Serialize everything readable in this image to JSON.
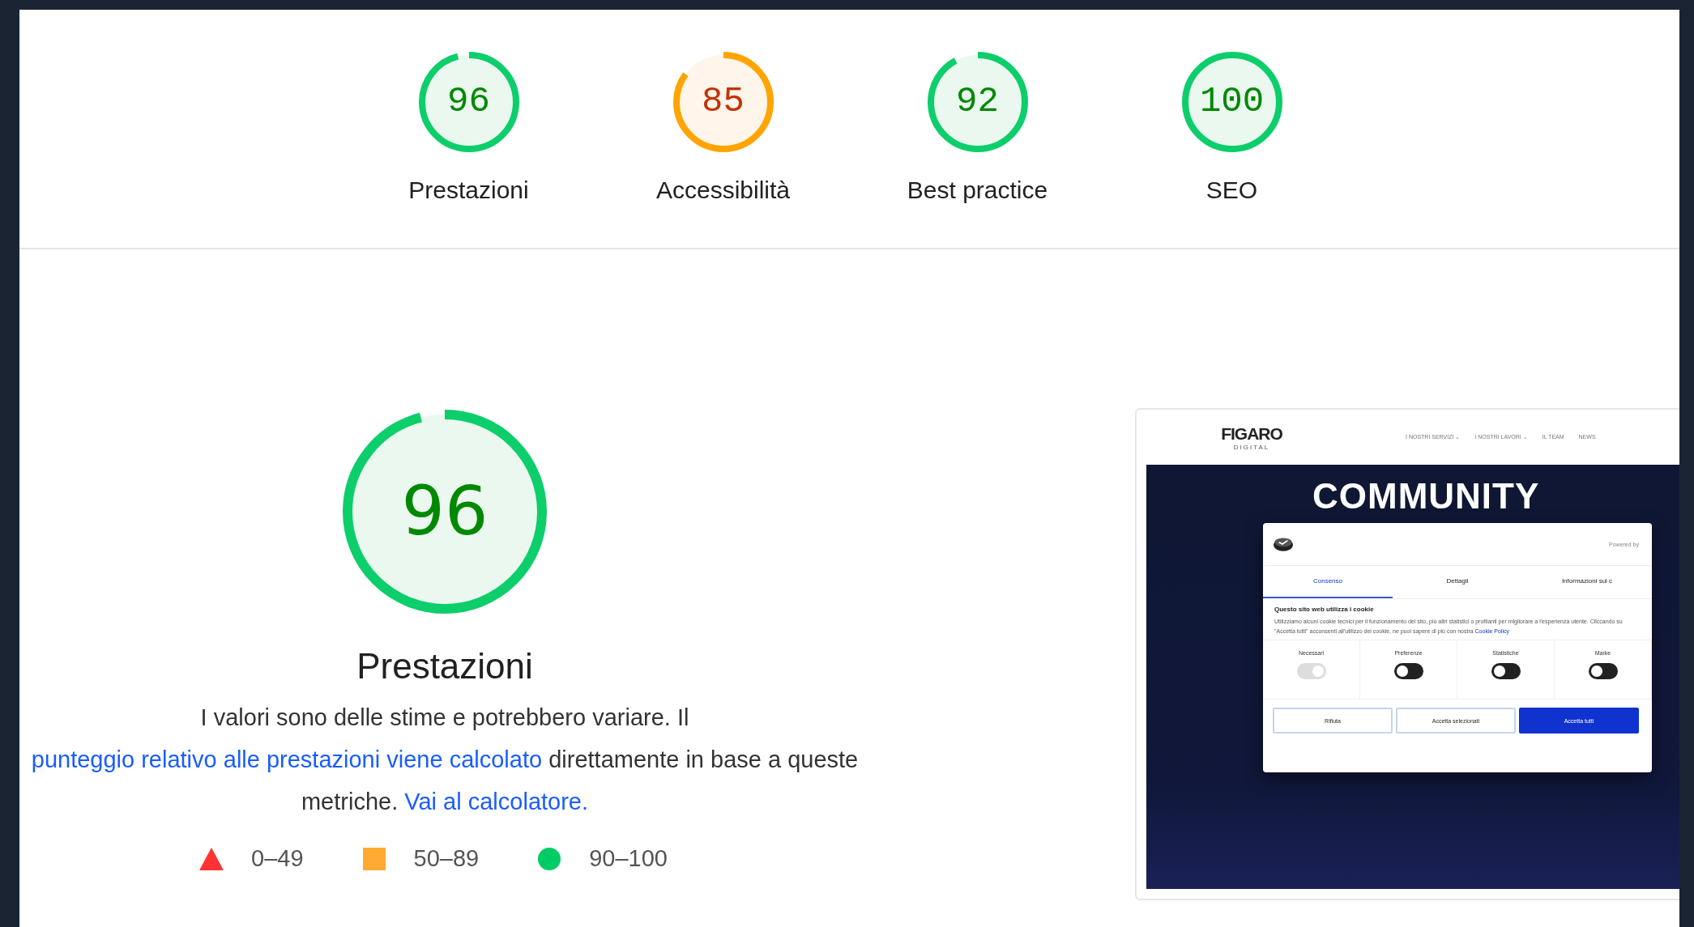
{
  "categories": [
    {
      "score": "96",
      "level": 0.96,
      "label": "Prestazioni"
    },
    {
      "score": "85",
      "level": 0.85,
      "label": "Accessibilità"
    },
    {
      "score": "92",
      "level": 0.92,
      "label": "Best practice"
    },
    {
      "score": "100",
      "level": 1,
      "label": "SEO"
    }
  ],
  "performance": {
    "score": "96",
    "level": 0.96,
    "title": "Prestazioni",
    "description": [
      {
        "text": "I valori sono delle stime e potrebbero variare. Il ",
        "kind": "text"
      },
      {
        "text": "punteggio relativo alle ",
        "kind": "link"
      },
      {
        "text": "prestazioni viene calcolato",
        "kind": "link"
      },
      {
        "text": " direttamente in base a queste metriche. ",
        "kind": "text"
      },
      {
        "text": "Vai al ",
        "kind": "link"
      },
      {
        "text": "calcolatore.",
        "kind": "link"
      }
    ],
    "legend": [
      {
        "kind": "triangle",
        "color": "#ff3333",
        "label": "0–49"
      },
      {
        "kind": "square",
        "color": "#ffaa33",
        "label": "50–89"
      },
      {
        "kind": "circle",
        "color": "#00cc66",
        "label": "90–100"
      }
    ]
  },
  "thumbnail": {
    "logo": "FIGARO",
    "logo_sub": "DIGITAL",
    "nav": [
      "I NOSTRI SERVIZI ⌄",
      "I NOSTRI LAVORI ⌄",
      "IL TEAM",
      "NEWS"
    ],
    "hero": "COMMUNITY",
    "dialog": {
      "powered": "Powered by",
      "tabs": [
        {
          "label": "Consenso",
          "selected": true
        },
        {
          "label": "Dettagli",
          "selected": false
        },
        {
          "label": "Informazioni sui c",
          "selected": false
        }
      ],
      "heading": "Questo sito web utilizza i cookie",
      "body": "Utilizziamo alcuni cookie tecnici per il funzionamento del sito, più altri statistici o profilanti per migliorare a l'esperienza utente. Cliccando su \"Accetta tutti\" acconsenti all'utilizzo dei cookie, ne puoi sapere di più con",
      "policy_prefix": "nostra",
      "policy_link": "Cookie Policy",
      "toggles": [
        {
          "label": "Necessari",
          "on": true,
          "disabled": true
        },
        {
          "label": "Preferenze",
          "on": false,
          "disabled": false
        },
        {
          "label": "Statistiche",
          "on": false,
          "disabled": false
        },
        {
          "label": "Marke",
          "on": false,
          "disabled": false
        }
      ],
      "buttons": [
        {
          "label": "Rifiuta",
          "kind": "outline"
        },
        {
          "label": "Accetta selezionati",
          "kind": "outline"
        },
        {
          "label": "Accetta tutti",
          "kind": "primary"
        }
      ]
    }
  }
}
